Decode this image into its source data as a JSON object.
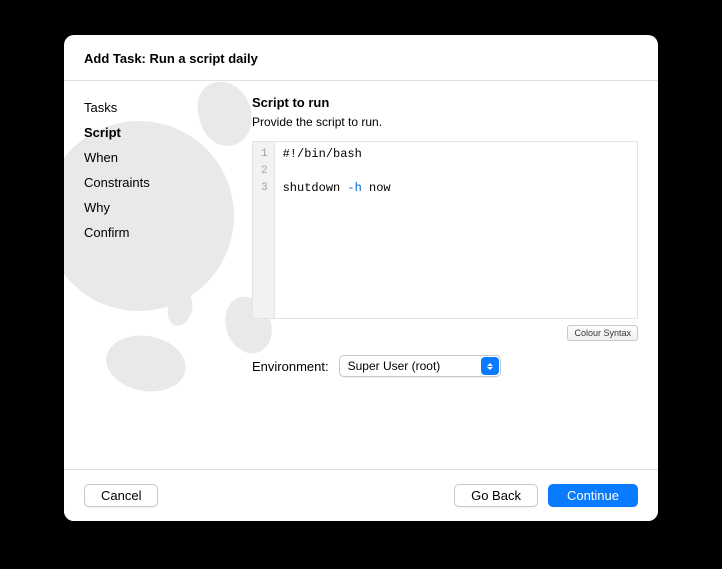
{
  "header": {
    "title": "Add Task: Run a script daily"
  },
  "sidebar": {
    "items": [
      {
        "label": "Tasks",
        "active": false
      },
      {
        "label": "Script",
        "active": true
      },
      {
        "label": "When",
        "active": false
      },
      {
        "label": "Constraints",
        "active": false
      },
      {
        "label": "Why",
        "active": false
      },
      {
        "label": "Confirm",
        "active": false
      }
    ]
  },
  "main": {
    "title": "Script to run",
    "subtitle": "Provide the script to run.",
    "code": {
      "lines": [
        {
          "num": "1",
          "text": "#!/bin/bash"
        },
        {
          "num": "2",
          "text": ""
        },
        {
          "num": "3",
          "prefix": "shutdown ",
          "flag": "-h",
          "suffix": " now"
        }
      ]
    },
    "syntax_button": "Colour Syntax",
    "environment": {
      "label": "Environment:",
      "value": "Super User (root)"
    }
  },
  "footer": {
    "cancel": "Cancel",
    "back": "Go Back",
    "continue": "Continue"
  }
}
